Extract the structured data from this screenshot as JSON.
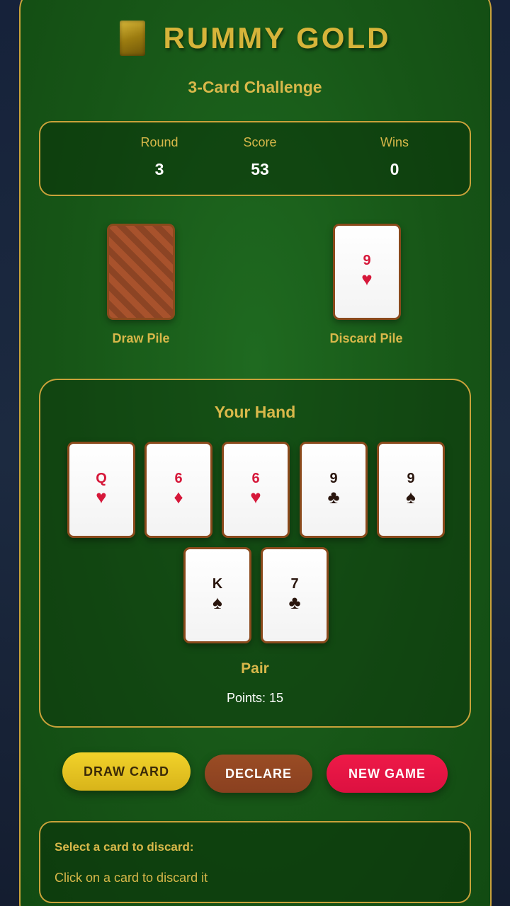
{
  "header": {
    "title": "RUMMY GOLD",
    "subtitle": "3-Card Challenge"
  },
  "stats": {
    "round_label": "Round",
    "round_value": "3",
    "score_label": "Score",
    "score_value": "53",
    "wins_label": "Wins",
    "wins_value": "0"
  },
  "piles": {
    "draw_label": "Draw Pile",
    "discard_label": "Discard Pile",
    "discard_top": {
      "rank": "9",
      "suit": "♥",
      "color": "red"
    }
  },
  "hand": {
    "title": "Your Hand",
    "cards": [
      {
        "rank": "Q",
        "suit": "♥",
        "color": "red"
      },
      {
        "rank": "6",
        "suit": "♦",
        "color": "red"
      },
      {
        "rank": "6",
        "suit": "♥",
        "color": "red"
      },
      {
        "rank": "9",
        "suit": "♣",
        "color": "black"
      },
      {
        "rank": "9",
        "suit": "♠",
        "color": "black"
      },
      {
        "rank": "K",
        "suit": "♠",
        "color": "black"
      },
      {
        "rank": "7",
        "suit": "♣",
        "color": "black"
      }
    ],
    "combo": "Pair",
    "points": "Points: 15"
  },
  "buttons": {
    "draw": "DRAW CARD",
    "declare": "DECLARE",
    "new_game": "NEW GAME"
  },
  "message": {
    "title": "Select a card to discard:",
    "text": "Click on a card to discard it"
  },
  "colors": {
    "felt": "#1a5e1b",
    "gold": "#d8b84a",
    "red_suit": "#d6183a",
    "black_suit": "#2a160e"
  }
}
